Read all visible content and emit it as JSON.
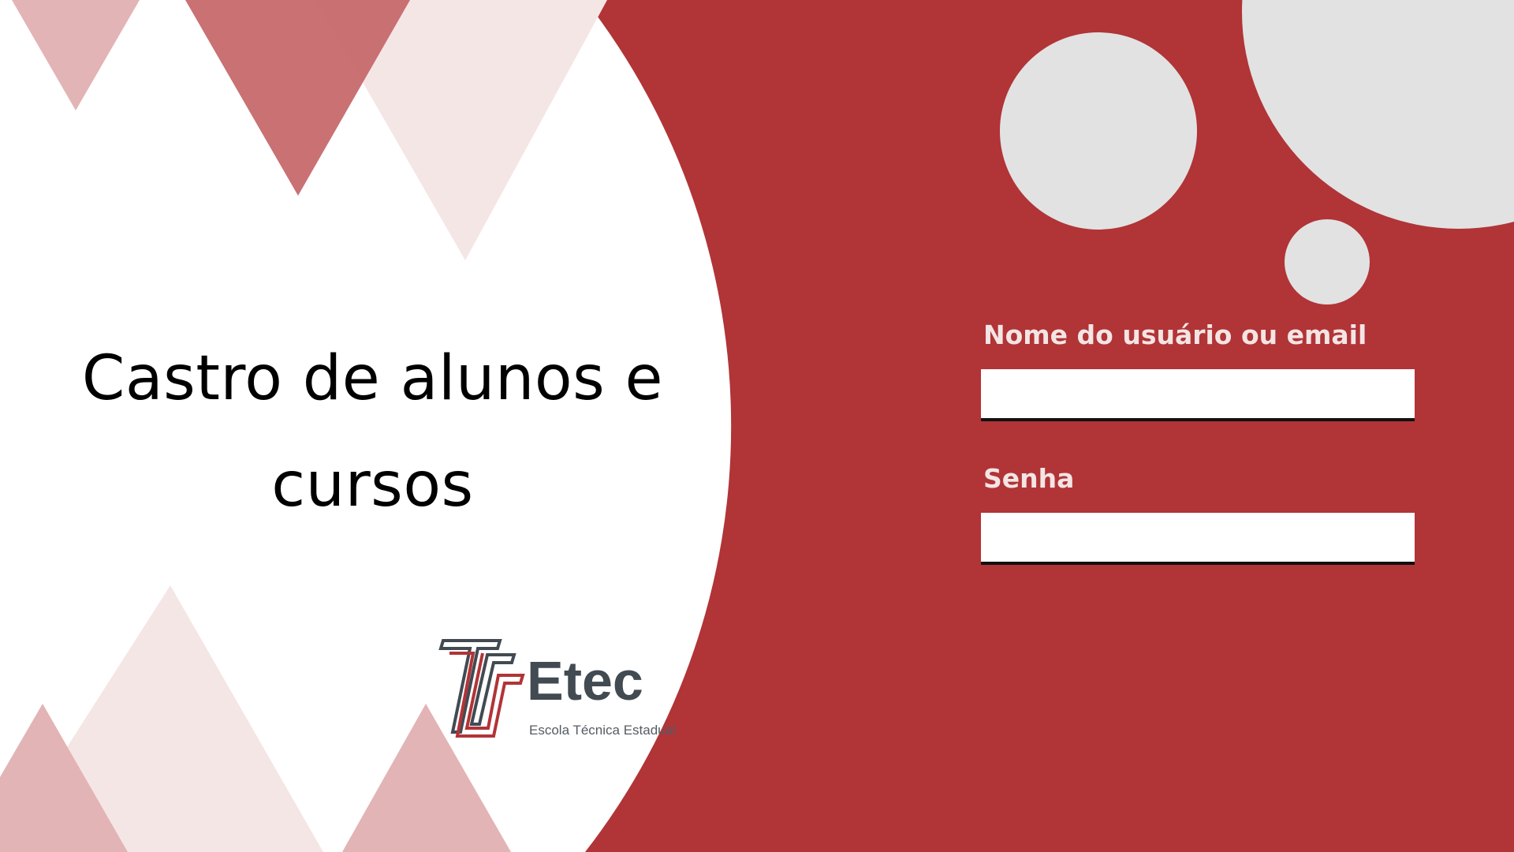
{
  "title": "Castro de alunos e cursos",
  "logo": {
    "word": "Etec",
    "subtitle": "Escola Técnica Estadual"
  },
  "login_form": {
    "username_label": "Nome do usuário ou email",
    "username_value": "",
    "password_label": "Senha",
    "password_value": ""
  },
  "colors": {
    "panel_red": "#b13437",
    "left_white": "#ffffff",
    "circle_gray": "#e2e2e2",
    "triangle_dark": "#c6696b",
    "triangle_mid": "#e3b4b5",
    "triangle_light": "#f5e6e6",
    "logo_red": "#b13437",
    "logo_gray": "#424a52"
  }
}
